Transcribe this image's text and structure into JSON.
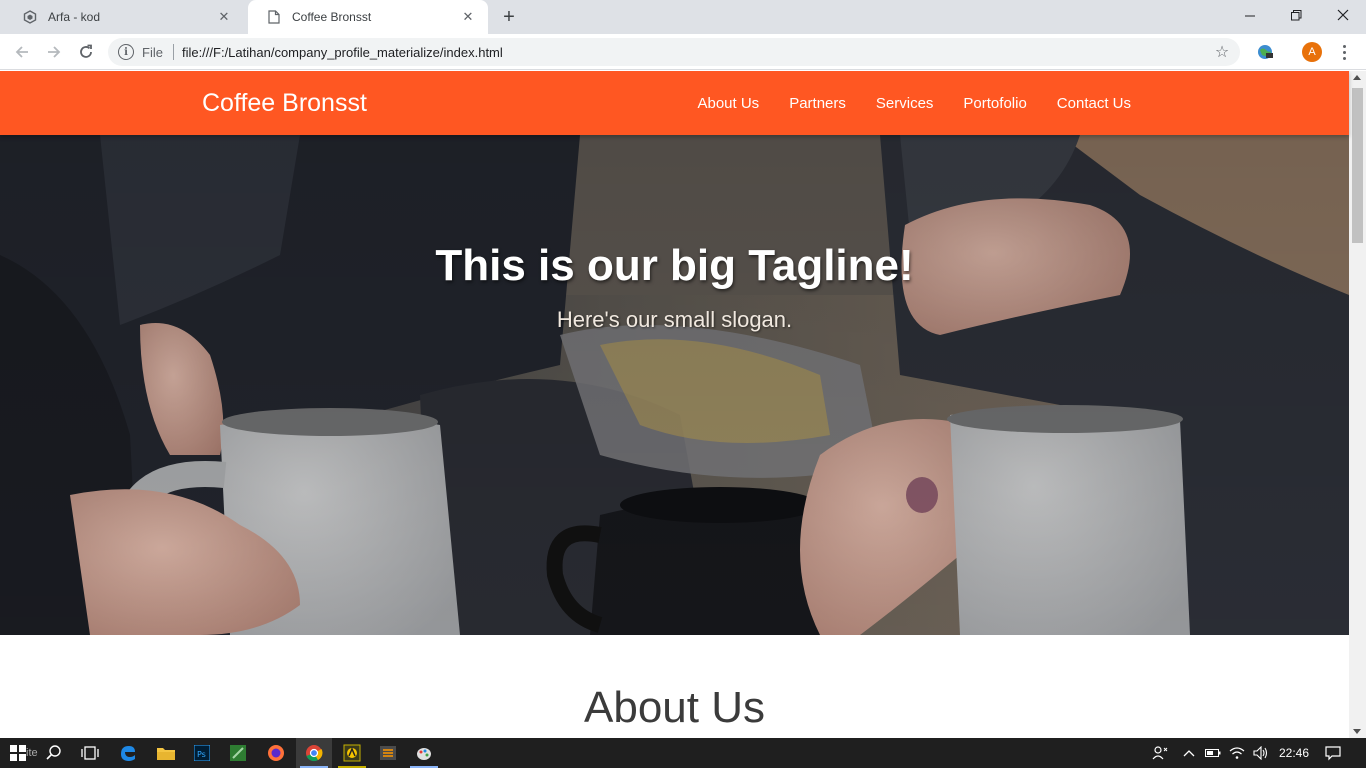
{
  "browser": {
    "tabs": [
      {
        "title": "Arfa - kod",
        "active": false
      },
      {
        "title": "Coffee Bronsst",
        "active": true
      }
    ],
    "new_tab_label": "+",
    "url_scheme": "File",
    "url": "file:///F:/Latihan/company_profile_materialize/index.html",
    "profile_initial": "A"
  },
  "site": {
    "brand": "Coffee Bronsst",
    "nav": [
      "About Us",
      "Partners",
      "Services",
      "Portofolio",
      "Contact Us"
    ],
    "hero": {
      "tagline": "This is our big Tagline!",
      "slogan": "Here's our small slogan."
    },
    "about_title": "About Us"
  },
  "taskbar": {
    "ghost_text": "ite",
    "clock": "22:46",
    "apps": [
      "start-icon",
      "search-icon",
      "task-view-icon",
      "edge-icon",
      "file-explorer-icon",
      "photoshop-icon",
      "coreldraw-icon",
      "firefox-icon",
      "chrome-icon",
      "app-icon",
      "sublime-icon",
      "paint-icon"
    ]
  },
  "colors": {
    "nav_accent": "#ff5722",
    "tabstrip": "#dee1e6",
    "taskbar": "#1f1f1f"
  }
}
